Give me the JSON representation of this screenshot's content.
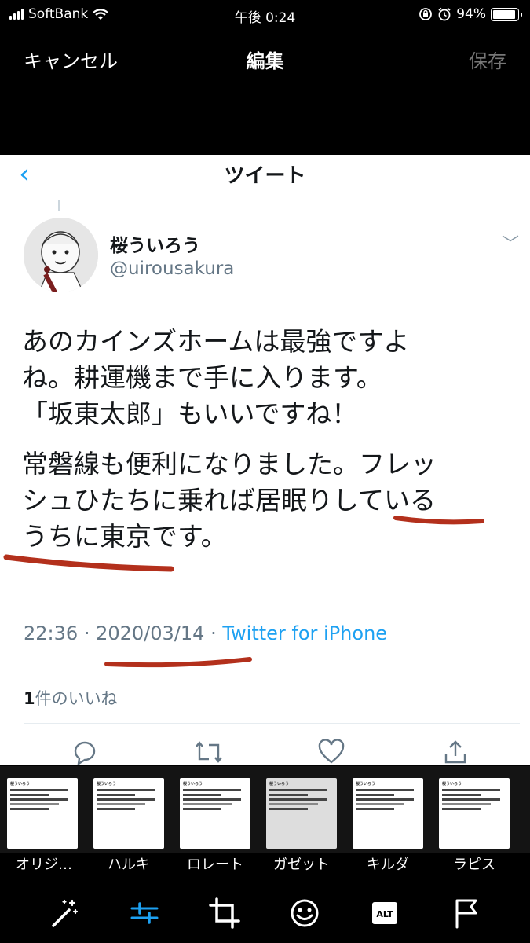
{
  "status": {
    "carrier": "SoftBank",
    "time": "午後 0:24",
    "battery": "94%",
    "battery_level": 0.94
  },
  "editor": {
    "cancel": "キャンセル",
    "title": "編集",
    "save": "保存"
  },
  "tweet": {
    "nav_title": "ツイート",
    "name": "桜ういろう",
    "handle": "@uirousakura",
    "lines": [
      "あのカインズホームは最強ですよ",
      "ね。耕運機まで手に入ります。",
      "「坂東太郎」もいいですね！"
    ],
    "lines2": [
      "常磐線も便利になりました。フレッ",
      "シュひたちに乗れば居眠りしている",
      "うちに東京です。"
    ],
    "time": "22:36",
    "sep": "·",
    "date": "2020/03/14",
    "source": "Twitter for iPhone",
    "likes_count": "1",
    "likes_label": "件のいいね"
  },
  "filters": [
    {
      "label": "オリジ…"
    },
    {
      "label": "ハルキ"
    },
    {
      "label": "ロレート"
    },
    {
      "label": "ガゼット"
    },
    {
      "label": "キルダ"
    },
    {
      "label": "ラピス"
    }
  ],
  "thumb_text": {
    "name": "桜ういろう",
    "alt": "ALT"
  },
  "toolbar": {
    "icons": [
      "magic-wand-icon",
      "adjust-sliders-icon",
      "crop-icon",
      "sticker-icon",
      "alt-text-icon",
      "flag-icon"
    ]
  },
  "colors": {
    "twitter_blue": "#1da1f2",
    "underline_red": "#b3301c",
    "active_tool": "#1da1f2"
  }
}
